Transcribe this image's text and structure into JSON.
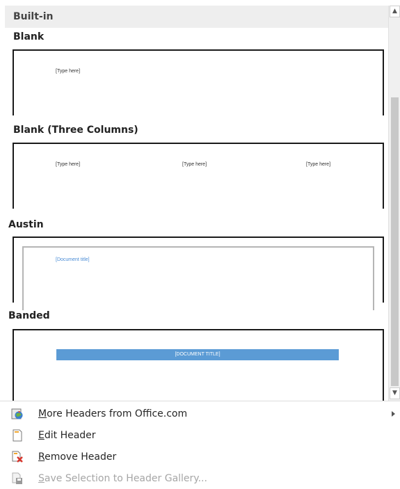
{
  "gallery": {
    "category": "Built-in",
    "items": [
      {
        "title": "Blank",
        "placeholders": [
          "[Type here]"
        ]
      },
      {
        "title": "Blank (Three Columns)",
        "placeholders": [
          "[Type here]",
          "[Type here]",
          "[Type here]"
        ]
      },
      {
        "title": "Austin",
        "placeholders": [
          "[Document title]"
        ]
      },
      {
        "title": "Banded",
        "placeholders": [
          "[DOCUMENT TITLE]"
        ]
      }
    ]
  },
  "colors": {
    "accent_blue": "#5b9bd5",
    "austin_title_blue": "#4a8cd6"
  },
  "menu": {
    "more_headers": {
      "accel": "M",
      "rest": "ore Headers from Office.com",
      "icon": "office-globe-icon"
    },
    "edit_header": {
      "accel": "E",
      "rest": "dit Header",
      "icon": "edit-page-icon"
    },
    "remove_header": {
      "accel": "R",
      "rest": "emove Header",
      "icon": "remove-page-icon"
    },
    "save_selection": {
      "accel": "S",
      "rest": "ave Selection to Header Gallery...",
      "icon": "save-to-gallery-icon"
    }
  }
}
